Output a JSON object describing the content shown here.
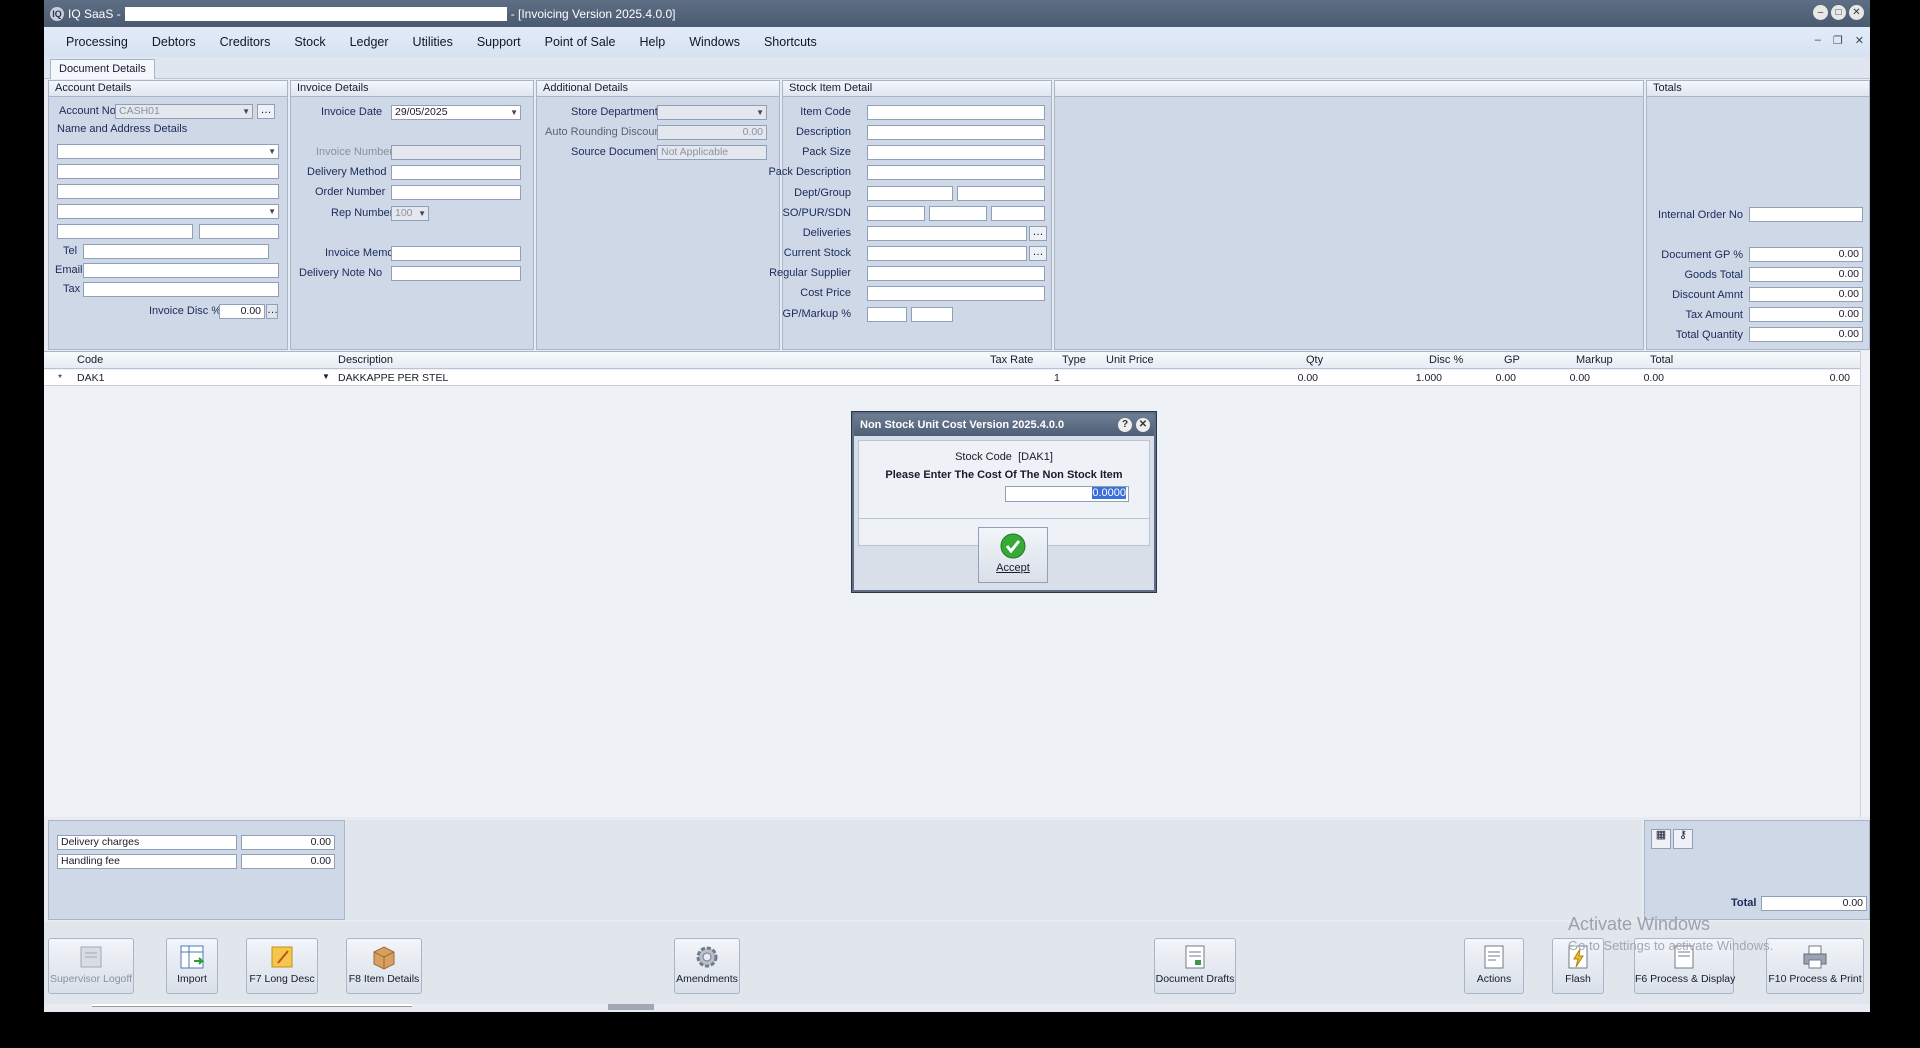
{
  "window": {
    "app_name": "IQ SaaS -",
    "title_suffix": "- [Invoicing Version 2025.4.0.0]"
  },
  "menu": [
    "Processing",
    "Debtors",
    "Creditors",
    "Stock",
    "Ledger",
    "Utilities",
    "Support",
    "Point of Sale",
    "Help",
    "Windows",
    "Shortcuts"
  ],
  "tab": {
    "label": "Document Details"
  },
  "account_details": {
    "header": "Account Details",
    "account_no_label": "Account No",
    "account_no_value": "CASH01",
    "name_address_label": "Name and Address Details",
    "tel_label": "Tel",
    "email_label": "Email",
    "tax_label": "Tax",
    "invoice_disc_label": "Invoice Disc %",
    "invoice_disc_value": "0.00"
  },
  "invoice_details": {
    "header": "Invoice Details",
    "invoice_date_label": "Invoice Date",
    "invoice_date_value": "29/05/2025",
    "invoice_number_label": "Invoice Number",
    "delivery_method_label": "Delivery Method",
    "order_number_label": "Order Number",
    "rep_number_label": "Rep Number",
    "rep_number_value": "100",
    "invoice_memo_label": "Invoice Memo",
    "delivery_note_label": "Delivery Note No"
  },
  "additional_details": {
    "header": "Additional Details",
    "store_department_label": "Store Department",
    "auto_rounding_label": "Auto Rounding Discount",
    "auto_rounding_value": "0.00",
    "source_document_label": "Source Document",
    "source_document_value": "Not Applicable"
  },
  "stock_item_detail": {
    "header": "Stock Item Detail",
    "labels": [
      "Item Code",
      "Description",
      "Pack Size",
      "Pack Description",
      "Dept/Group",
      "SO/PUR/SDN",
      "Deliveries",
      "Current Stock",
      "Regular Supplier",
      "Cost Price",
      "GP/Markup %"
    ]
  },
  "totals": {
    "header": "Totals",
    "internal_order_label": "Internal Order No",
    "document_gp_label": "Document GP %",
    "document_gp_value": "0.00",
    "goods_total_label": "Goods Total",
    "goods_total_value": "0.00",
    "discount_amnt_label": "Discount Amnt",
    "discount_amnt_value": "0.00",
    "tax_amount_label": "Tax Amount",
    "tax_amount_value": "0.00",
    "total_quantity_label": "Total Quantity",
    "total_quantity_value": "0.00"
  },
  "grid": {
    "columns": [
      "Code",
      "Description",
      "Tax Rate",
      "Type",
      "Unit Price",
      "Qty",
      "Disc %",
      "GP",
      "Markup",
      "Total"
    ],
    "rows": [
      {
        "marker": "*",
        "code": "DAK1",
        "description": "DAKKAPPE PER STEL",
        "tax_rate": "1",
        "type": "",
        "unit_price": "0.00",
        "qty": "1.000",
        "disc": "0.00",
        "gp": "0.00",
        "markup": "0.00",
        "total": "0.00"
      }
    ]
  },
  "charges": {
    "delivery_label": "Delivery charges",
    "delivery_value": "0.00",
    "handling_label": "Handling fee",
    "handling_value": "0.00"
  },
  "grand_total": {
    "label": "Total",
    "value": "0.00"
  },
  "toolbar": {
    "supervisor_logoff": "Supervisor Logoff",
    "import": "Import",
    "f7_long_desc": "F7 Long Desc",
    "f8_item_details": "F8 Item Details",
    "amendments": "Amendments",
    "document_drafts": "Document Drafts",
    "actions": "Actions",
    "flash": "Flash",
    "f6_process_display": "F6 Process & Display",
    "f10_process_print": "F10 Process & Print"
  },
  "watermark": {
    "line1": "Activate Windows",
    "line2": "Go to Settings to activate Windows."
  },
  "dialog": {
    "title": "Non Stock Unit Cost Version 2025.4.0.0",
    "stock_code_label": "Stock Code",
    "stock_code_value": "[DAK1]",
    "prompt": "Please Enter The Cost Of The Non Stock Item",
    "cost_value": "0.0000",
    "accept_label": "Accept"
  }
}
